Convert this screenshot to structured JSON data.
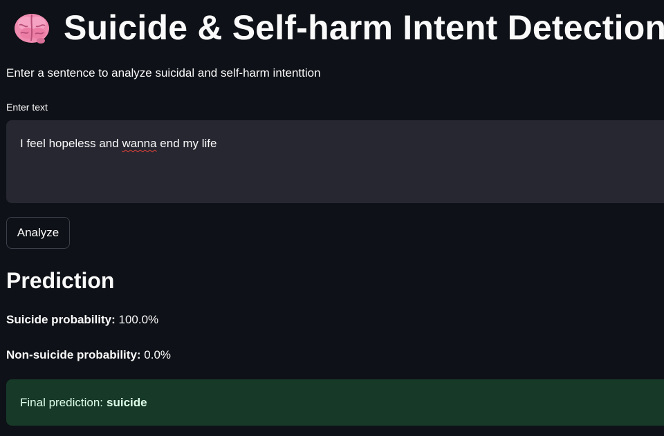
{
  "header": {
    "icon": "brain-icon",
    "title": "Suicide & Self-harm Intent Detection"
  },
  "intro": {
    "subtitle": "Enter a sentence to analyze suicidal and self-harm intenttion"
  },
  "input": {
    "label": "Enter text",
    "value_before": "I feel hopeless and ",
    "value_misspelled": "wanna",
    "value_after": " end my life"
  },
  "actions": {
    "analyze_label": "Analyze"
  },
  "prediction": {
    "heading": "Prediction",
    "suicide_label": "Suicide probability:",
    "suicide_value": "100.0%",
    "non_suicide_label": "Non-suicide probability:",
    "non_suicide_value": "0.0%",
    "final_label": "Final prediction:",
    "final_value": "suicide"
  },
  "colors": {
    "background": "#0e1117",
    "input_background": "#262730",
    "success_background": "#173928",
    "success_text": "#dffde9"
  }
}
